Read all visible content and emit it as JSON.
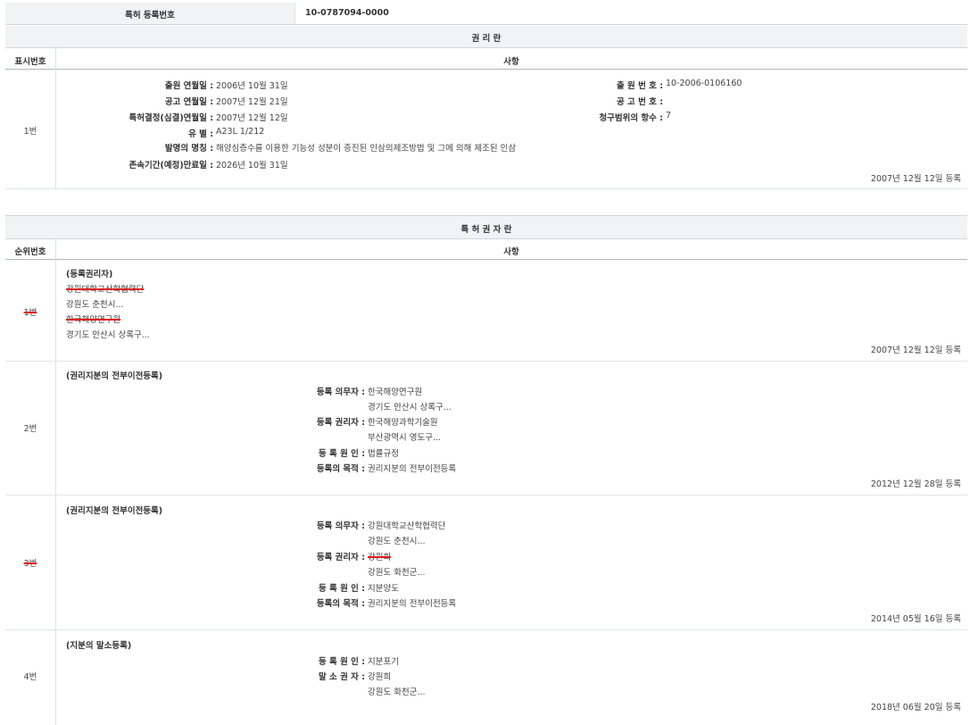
{
  "reg_no": {
    "label": "특허 등록번호",
    "value": "10-0787094-0000"
  },
  "rights_section": {
    "title": "권 리 란",
    "col_no": "표시번호",
    "col_item": "사항",
    "entry_no": "1번",
    "left_labels": [
      "출원 연월일 :",
      "공고 연월일 :",
      "특허결정(심결)연월일 :",
      "유 별 :",
      "발명의 명칭 :",
      "존속기간(예정)만료일 :"
    ],
    "left_values": [
      "2006년 10월 31일",
      "2007년 12월 21일",
      "2007년 12월 12일",
      "A23L 1/212",
      "해양심층수를 이용한 기능성 성분이 증진된 인삼의제조방법 및 그에 의해 제조된 인삼",
      "2026년 10월 31일"
    ],
    "right_labels": [
      "출 원 번 호 :",
      "공 고 번 호 :",
      "청구범위의 항수 :"
    ],
    "right_values": [
      "10-2006-0106160",
      "",
      "7"
    ],
    "date": "2007년 12월 12일 등록"
  },
  "holder_section": {
    "title": "특 허 권 자 란",
    "col_no": "순위번호",
    "col_item": "사항",
    "rows": [
      {
        "no": "1번",
        "heading": "(등록권리자)",
        "lines": [
          "강원대학교산학협력단",
          "강원도 춘천시...",
          "한국해양연구원",
          "경기도 안산시 상록구..."
        ],
        "date": "2007년 12월 12일 등록"
      },
      {
        "no": "2번",
        "heading": "(권리지분의 전부이전등록)",
        "labels": [
          "등록 의무자 :",
          "등록 권리자 :",
          "등 록 원 인 :",
          "등록의 목적 :"
        ],
        "values": [
          "한국해양연구원",
          "경기도 안산시 상록구...",
          "한국해양과학기술원",
          "부산광역시 영도구...",
          "법률규정",
          "권리지분의 전부이전등록"
        ],
        "date": "2012년 12월 28일 등록"
      },
      {
        "no": "3번",
        "heading": "(권리지분의 전부이전등록)",
        "labels": [
          "등록 의무자 :",
          "등록 권리자 :",
          "등 록 원 인 :",
          "등록의 목적 :"
        ],
        "values": [
          "강원대학교산학협력단",
          "강원도 춘천시...",
          "강원희",
          "강원도 화천군...",
          "지분양도",
          "권리지분의 전부이전등록"
        ],
        "date": "2014년 05월 16일 등록"
      },
      {
        "no": "4번",
        "heading": "(지분의 말소등록)",
        "labels": [
          "등 록 원 인 :",
          "말 소 권 자 :"
        ],
        "values": [
          "지분포기",
          "강원희",
          "강원도 화천군..."
        ],
        "date": "2018년 06월 20일 등록"
      }
    ]
  }
}
